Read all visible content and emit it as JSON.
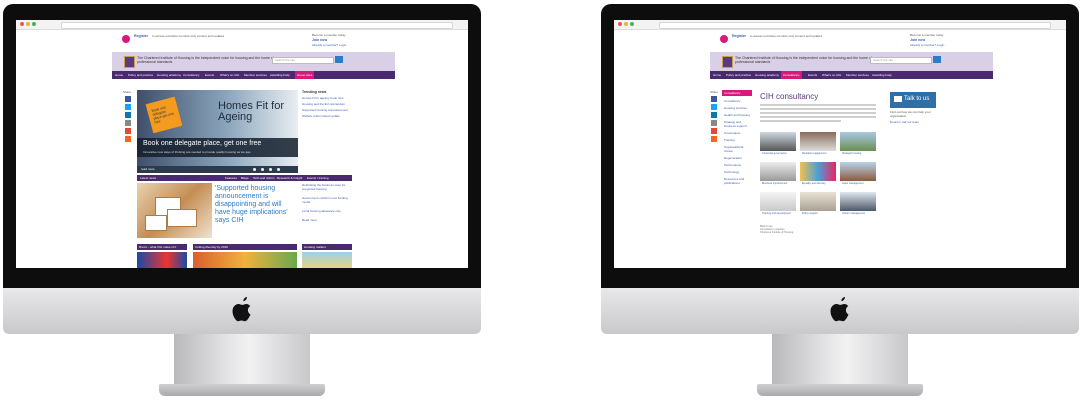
{
  "colors": {
    "purple": "#4a2a6e",
    "lilac": "#d9cfe6",
    "magenta": "#d6197a",
    "link_blue": "#2b7cc9",
    "bezel": "#0d0d0d",
    "silver": "#d9d9dc"
  },
  "left_screen": {
    "topstrip": {
      "register_label": "Register",
      "register_text": "to access exclusive member-only content and updates",
      "member_title": "Become a member today",
      "member_link": "Join now",
      "login_link": "Already a member? Login"
    },
    "header": {
      "org_name": "The Chartered Institute of Housing is the independent voice for housing and the home of professional standards",
      "search_placeholder": "Search the site"
    },
    "nav": [
      "Home",
      "Policy and practice",
      "Housing academy",
      "Consultancy",
      "Events",
      "What's on CIH",
      "Member services",
      "Awarding body",
      "Group sites"
    ],
    "hero": {
      "title": "Homes Fit for Ageing",
      "banner_title": "Book one delegate place, get one free",
      "banner_sub": "Innovative new ways of thinking are needed to provide quality housing as we age",
      "tag_text": "Book one delegate place get one free",
      "more_label": "read more"
    },
    "trending": {
      "heading": "Trending news",
      "items": [
        "Homes fit for ageing: book now",
        "Housing and the EU referendum",
        "Supported housing announcement",
        "Welfare reform latest update"
      ]
    },
    "tabs": [
      "Latest news",
      "Features",
      "Blogs",
      "Tech and reform",
      "Research & Insight",
      "Events / training"
    ],
    "story": {
      "headline": "'Supported housing announcement is disappointing and will have huge implications' says CIH"
    },
    "side_links": [
      "Rethinking the business case for supported housing",
      "Government confirms new funding model",
      "Local housing allowance cap",
      "Read more"
    ],
    "bottom_cards": [
      "Brexit – what CIH make of it",
      "Cutting diversity by 2019",
      "Housing matters"
    ],
    "share_label": "Share"
  },
  "right_screen": {
    "left_nav": {
      "heading": "Consultancy",
      "items": [
        "Consultancy",
        "Housing services",
        "Health and housing",
        "Strategy and business support",
        "Governance",
        "Training",
        "Organisational review",
        "Regeneration",
        "Performance",
        "Technology",
        "Resources and publications"
      ]
    },
    "page_title": "CIH consultancy",
    "grid_captions": [
      "Corporate governance",
      "Resident engagement",
      "Strategic housing",
      "Business improvement",
      "Equality and diversity",
      "Asset management",
      "Training and development",
      "Policy support",
      "Interim management"
    ],
    "talk": {
      "label": "Talk to us",
      "lines": [
        "Find out how we can help your organisation",
        "Email or call our team"
      ]
    },
    "footer_lines": [
      "Back to top",
      "Consultancy enquiries",
      "Chartered Institute of Housing"
    ],
    "share_label": "Share"
  }
}
